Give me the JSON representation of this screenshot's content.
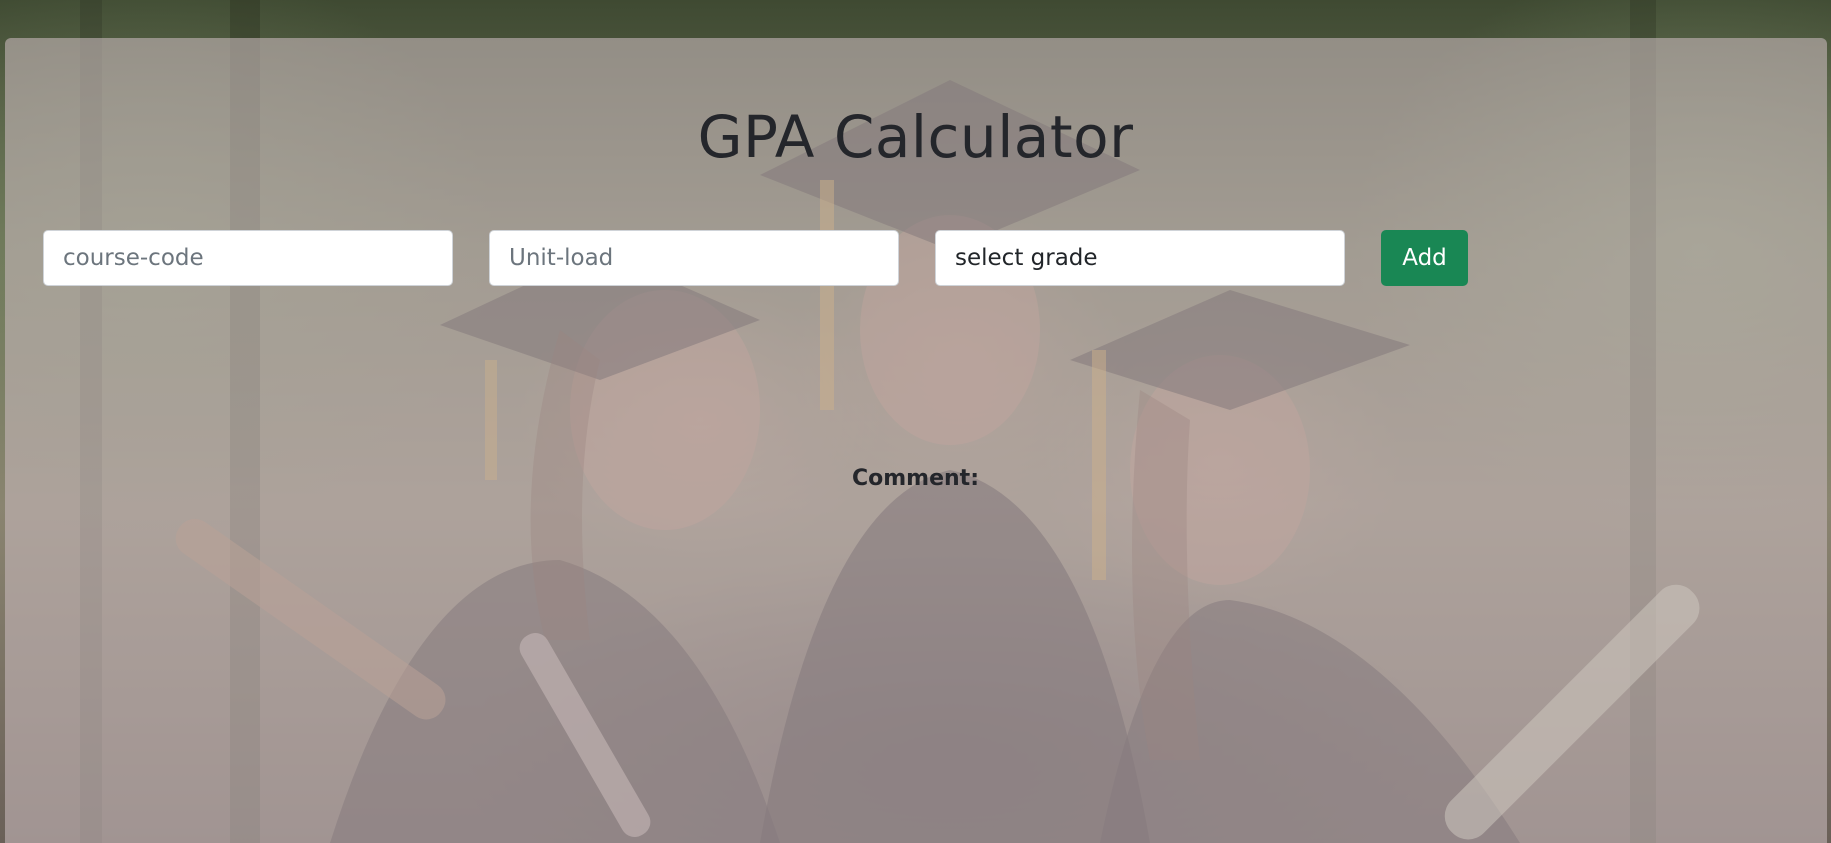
{
  "app": {
    "title": "GPA Calculator"
  },
  "form": {
    "course_code": {
      "placeholder": "course-code",
      "value": ""
    },
    "unit_load": {
      "placeholder": "Unit-load",
      "value": ""
    },
    "grade_select": {
      "selected": "select grade"
    },
    "add_label": "Add"
  },
  "result": {
    "comment_label": "Comment:"
  },
  "colors": {
    "accent": "#198754",
    "text": "#24262b",
    "panel_overlay": "rgba(196,180,182,0.62)"
  },
  "background": {
    "image_subject": "graduation-photo"
  }
}
